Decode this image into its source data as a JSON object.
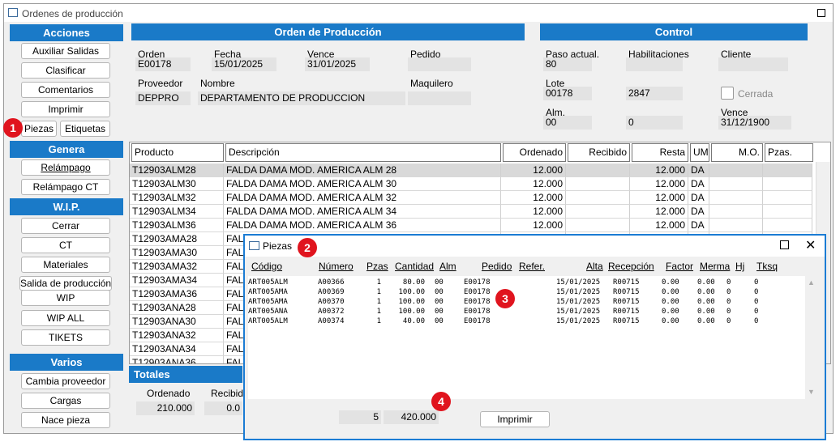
{
  "window": {
    "title": "Ordenes de producción"
  },
  "acciones": {
    "header": "Acciones",
    "buttons": [
      "Auxiliar Salidas",
      "Clasificar",
      "Comentarios",
      "Imprimir"
    ],
    "piezas": "Piezas",
    "etiquetas": "Etiquetas"
  },
  "genera": {
    "header": "Genera",
    "buttons": [
      "Relámpago",
      "Relámpago CT"
    ]
  },
  "wip": {
    "header": "W.I.P.",
    "buttons": [
      "Cerrar",
      "CT",
      "Materiales",
      "Salida de producción",
      "WIP",
      "WIP ALL",
      "TIKETS"
    ]
  },
  "varios": {
    "header": "Varios",
    "buttons": [
      "Cambia proveedor",
      "Cargas",
      "Nace pieza"
    ]
  },
  "orden": {
    "header": "Orden de Producción",
    "orden_label": "Orden",
    "orden": "E00178",
    "fecha_label": "Fecha",
    "fecha": "15/01/2025",
    "vence_label": "Vence",
    "vence": "31/01/2025",
    "pedido_label": "Pedido",
    "pedido": "",
    "proveedor_label": "Proveedor",
    "proveedor": "DEPPRO",
    "nombre_label": "Nombre",
    "nombre": "DEPARTAMENTO  DE PRODUCCION",
    "maquilero_label": "Maquilero",
    "maquilero": ""
  },
  "control": {
    "header": "Control",
    "paso_label": "Paso actual.",
    "paso": "80",
    "hab_label": "Habilitaciones",
    "hab": "",
    "cliente_label": "Cliente",
    "cliente": "",
    "lote_label": "Lote",
    "lote": "00178",
    "lote2": "2847",
    "cerrada_label": "Cerrada",
    "alm_label": "Alm.",
    "alm": "00",
    "alm2": "0",
    "vence_label": "Vence",
    "vence": "31/12/1900"
  },
  "grid": {
    "headers": [
      "Producto",
      "Descripción",
      "Ordenado",
      "Recibido",
      "Resta",
      "UM",
      "M.O.",
      "Pzas."
    ],
    "rows": [
      {
        "producto": "T12903ALM28",
        "desc": "FALDA DAMA MOD. AMERICA ALM 28",
        "ordenado": "12.000",
        "recibido": "",
        "resta": "12.000",
        "um": "DA"
      },
      {
        "producto": "T12903ALM30",
        "desc": "FALDA DAMA MOD. AMERICA ALM 30",
        "ordenado": "12.000",
        "recibido": "",
        "resta": "12.000",
        "um": "DA"
      },
      {
        "producto": "T12903ALM32",
        "desc": "FALDA DAMA MOD. AMERICA ALM 32",
        "ordenado": "12.000",
        "recibido": "",
        "resta": "12.000",
        "um": "DA"
      },
      {
        "producto": "T12903ALM34",
        "desc": "FALDA DAMA MOD. AMERICA ALM 34",
        "ordenado": "12.000",
        "recibido": "",
        "resta": "12.000",
        "um": "DA"
      },
      {
        "producto": "T12903ALM36",
        "desc": "FALDA DAMA MOD. AMERICA ALM 36",
        "ordenado": "12.000",
        "recibido": "",
        "resta": "12.000",
        "um": "DA"
      },
      {
        "producto": "T12903AMA28",
        "desc": "FAL",
        "ordenado": "",
        "recibido": "",
        "resta": "",
        "um": ""
      },
      {
        "producto": "T12903AMA30",
        "desc": "FAL",
        "ordenado": "",
        "recibido": "",
        "resta": "",
        "um": ""
      },
      {
        "producto": "T12903AMA32",
        "desc": "FAL",
        "ordenado": "",
        "recibido": "",
        "resta": "",
        "um": ""
      },
      {
        "producto": "T12903AMA34",
        "desc": "FAL",
        "ordenado": "",
        "recibido": "",
        "resta": "",
        "um": ""
      },
      {
        "producto": "T12903AMA36",
        "desc": "FAL",
        "ordenado": "",
        "recibido": "",
        "resta": "",
        "um": ""
      },
      {
        "producto": "T12903ANA28",
        "desc": "FAL",
        "ordenado": "",
        "recibido": "",
        "resta": "",
        "um": ""
      },
      {
        "producto": "T12903ANA30",
        "desc": "FAL",
        "ordenado": "",
        "recibido": "",
        "resta": "",
        "um": ""
      },
      {
        "producto": "T12903ANA32",
        "desc": "FAL",
        "ordenado": "",
        "recibido": "",
        "resta": "",
        "um": ""
      },
      {
        "producto": "T12903ANA34",
        "desc": "FAL",
        "ordenado": "",
        "recibido": "",
        "resta": "",
        "um": ""
      },
      {
        "producto": "T12903ANA36",
        "desc": "FAL",
        "ordenado": "",
        "recibido": "",
        "resta": "",
        "um": ""
      }
    ]
  },
  "totales": {
    "header": "Totales",
    "ordenado_label": "Ordenado",
    "ordenado": "210.000",
    "recibido_label": "Recibido",
    "recibido": "0.0"
  },
  "piezas": {
    "title": "Piezas",
    "headers": [
      "Código",
      "Número",
      "Pzas",
      "Cantidad",
      "Alm",
      "Pedido",
      "Refer.",
      "Alta",
      "Recepción",
      "Factor",
      "Merma",
      "Hj",
      "Tksq"
    ],
    "rows": [
      {
        "codigo": "ART005ALM",
        "numero": "A00366",
        "pzas": "1",
        "cantidad": "80.00",
        "alm": "00",
        "pedido": "E00178",
        "refer": "",
        "alta": "15/01/2025",
        "recepcion": "R00715",
        "factor": "0.00",
        "merma": "0.00",
        "hj": "0",
        "tksq": "0"
      },
      {
        "codigo": "ART005AMA",
        "numero": "A00369",
        "pzas": "1",
        "cantidad": "100.00",
        "alm": "00",
        "pedido": "E00178",
        "refer": "",
        "alta": "15/01/2025",
        "recepcion": "R00715",
        "factor": "0.00",
        "merma": "0.00",
        "hj": "0",
        "tksq": "0"
      },
      {
        "codigo": "ART005AMA",
        "numero": "A00370",
        "pzas": "1",
        "cantidad": "100.00",
        "alm": "00",
        "pedido": "E00178",
        "refer": "",
        "alta": "15/01/2025",
        "recepcion": "R00715",
        "factor": "0.00",
        "merma": "0.00",
        "hj": "0",
        "tksq": "0"
      },
      {
        "codigo": "ART005ANA",
        "numero": "A00372",
        "pzas": "1",
        "cantidad": "100.00",
        "alm": "00",
        "pedido": "E00178",
        "refer": "",
        "alta": "15/01/2025",
        "recepcion": "R00715",
        "factor": "0.00",
        "merma": "0.00",
        "hj": "0",
        "tksq": "0"
      },
      {
        "codigo": "ART005ALM",
        "numero": "A00374",
        "pzas": "1",
        "cantidad": "40.00",
        "alm": "00",
        "pedido": "E00178",
        "refer": "",
        "alta": "15/01/2025",
        "recepcion": "R00715",
        "factor": "0.00",
        "merma": "0.00",
        "hj": "0",
        "tksq": "0"
      }
    ],
    "total_pzas": "5",
    "total_cantidad": "420.000",
    "imprimir": "Imprimir"
  },
  "badges": [
    "1",
    "2",
    "3",
    "4"
  ],
  "colors": {
    "header_blue": "#1a7ac8",
    "badge_red": "#e0141e",
    "dialog_border": "#1b7cd4"
  }
}
